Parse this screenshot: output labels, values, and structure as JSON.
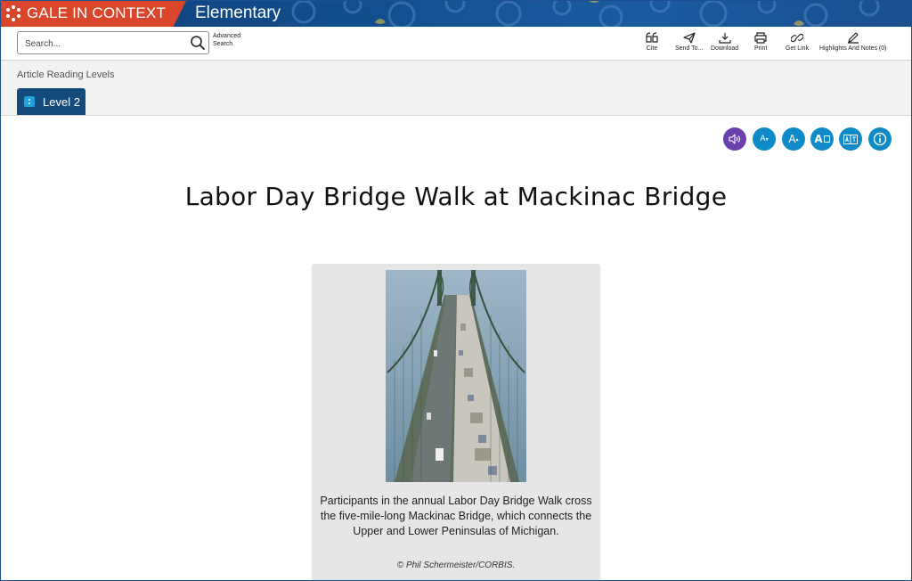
{
  "app": {
    "brand": "GALE IN CONTEXT",
    "edition": "Elementary"
  },
  "search": {
    "placeholder": "Search...",
    "advanced_line1": "Advanced",
    "advanced_line2": "Search"
  },
  "tools": {
    "cite": "Cite",
    "send": "Send To...",
    "download": "Download",
    "print": "Print",
    "getlink": "Get Link",
    "highlights": "Highlights And Notes (0)"
  },
  "levels": {
    "label": "Article Reading Levels",
    "current": "Level 2"
  },
  "reader_tools": {
    "decrease_font": "A",
    "increase_font": "A",
    "font_style": "A"
  },
  "article": {
    "title": "Labor Day Bridge Walk at Mackinac Bridge",
    "caption": "Participants in the annual Labor Day Bridge Walk cross the five-mile-long Mackinac Bridge, which connects the Upper and Lower Peninsulas of Michigan.",
    "credit": "© Phil Schermeister/CORBIS."
  },
  "colors": {
    "brand_red": "#d9462b",
    "banner_blue": "#13508f",
    "level_tab": "#154a7c",
    "accent_button": "#0e8ac7",
    "audio_button": "#6a3fae"
  }
}
